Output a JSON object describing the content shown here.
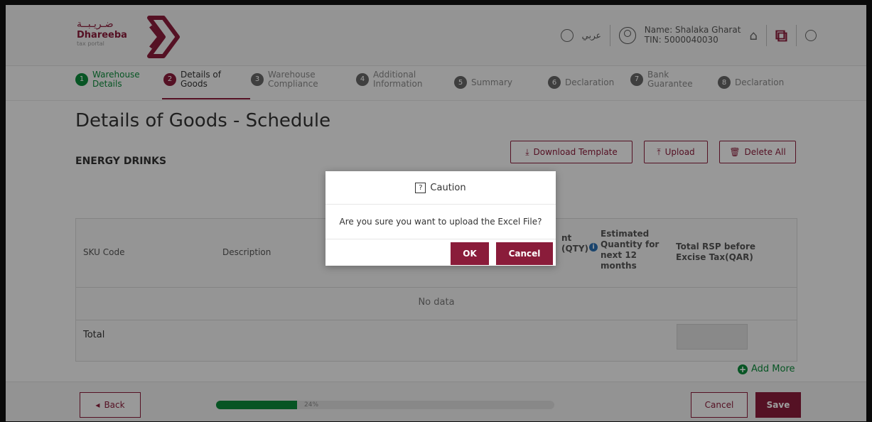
{
  "header": {
    "logo_arabic": "ضـريـبــة",
    "logo_name": "Dhareeba",
    "logo_sub": "tax portal",
    "language": "عربي",
    "user_name": "Name: Shalaka Gharat",
    "user_tin": "TIN: 5000040030"
  },
  "steps": [
    {
      "num": "1",
      "label": "Warehouse Details",
      "state": "done"
    },
    {
      "num": "2",
      "label": "Details of Goods",
      "state": "active"
    },
    {
      "num": "3",
      "label": "Warehouse Compliance",
      "state": "pending"
    },
    {
      "num": "4",
      "label": "Additional Information",
      "state": "pending"
    },
    {
      "num": "5",
      "label": "Summary",
      "state": "pending"
    },
    {
      "num": "6",
      "label": "Declaration",
      "state": "pending"
    },
    {
      "num": "7",
      "label": "Bank Guarantee",
      "state": "pending"
    },
    {
      "num": "8",
      "label": "Declaration",
      "state": "pending"
    }
  ],
  "page": {
    "title": "Details of Goods - Schedule",
    "section": "ENERGY DRINKS",
    "download_template": "Download Template",
    "upload": "Upload",
    "delete_all": "Delete All"
  },
  "table": {
    "col_sku": "SKU Code",
    "col_description": "Description",
    "col_qty_fragment": "nt\n(QTY)",
    "col_estimated": "Estimated\nQuantity for\nnext 12\nmonths",
    "col_rsp": "Total RSP before\nExcise Tax(QAR)",
    "no_data": "No data",
    "total_label": "Total",
    "add_more": "Add More"
  },
  "footer": {
    "back": "Back",
    "progress_text": "24%",
    "progress_value": 24,
    "cancel": "Cancel",
    "save": "Save"
  },
  "modal": {
    "title": "Caution",
    "message": "Are you sure you want to upload the Excel File?",
    "ok": "OK",
    "cancel": "Cancel"
  },
  "colors": {
    "brand": "#8a1c3a",
    "done": "#0c8a3a"
  }
}
